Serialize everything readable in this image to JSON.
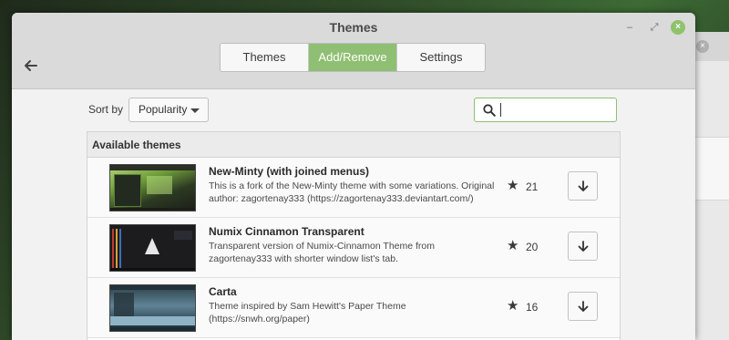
{
  "window": {
    "title": "Themes"
  },
  "tabs": [
    {
      "label": "Themes",
      "active": false
    },
    {
      "label": "Add/Remove",
      "active": true
    },
    {
      "label": "Settings",
      "active": false
    }
  ],
  "toolbar": {
    "sort_label": "Sort by",
    "sort_value": "Popularity",
    "search_value": ""
  },
  "list": {
    "header": "Available themes",
    "items": [
      {
        "name": "New-Minty (with joined menus)",
        "description": "This is a fork of the New-Minty theme with some variations. Original author: zagortenay333 (https://zagortenay333.deviantart.com/)",
        "score": "21"
      },
      {
        "name": "Numix Cinnamon Transparent",
        "description": "Transparent version of Numix-Cinnamon Theme from zagortenay333 with shorter window list's tab.",
        "score": "20"
      },
      {
        "name": "Carta",
        "description": "Theme inspired by Sam Hewitt's Paper Theme (https://snwh.org/paper)",
        "score": "16"
      }
    ]
  },
  "colors": {
    "accent": "#8fbf72",
    "titlebar": "#dadada",
    "close_button": "#8fc36b"
  },
  "icons": {
    "back": "arrow-left-icon",
    "search": "search-icon",
    "star": "star-icon",
    "download": "arrow-down-icon"
  }
}
